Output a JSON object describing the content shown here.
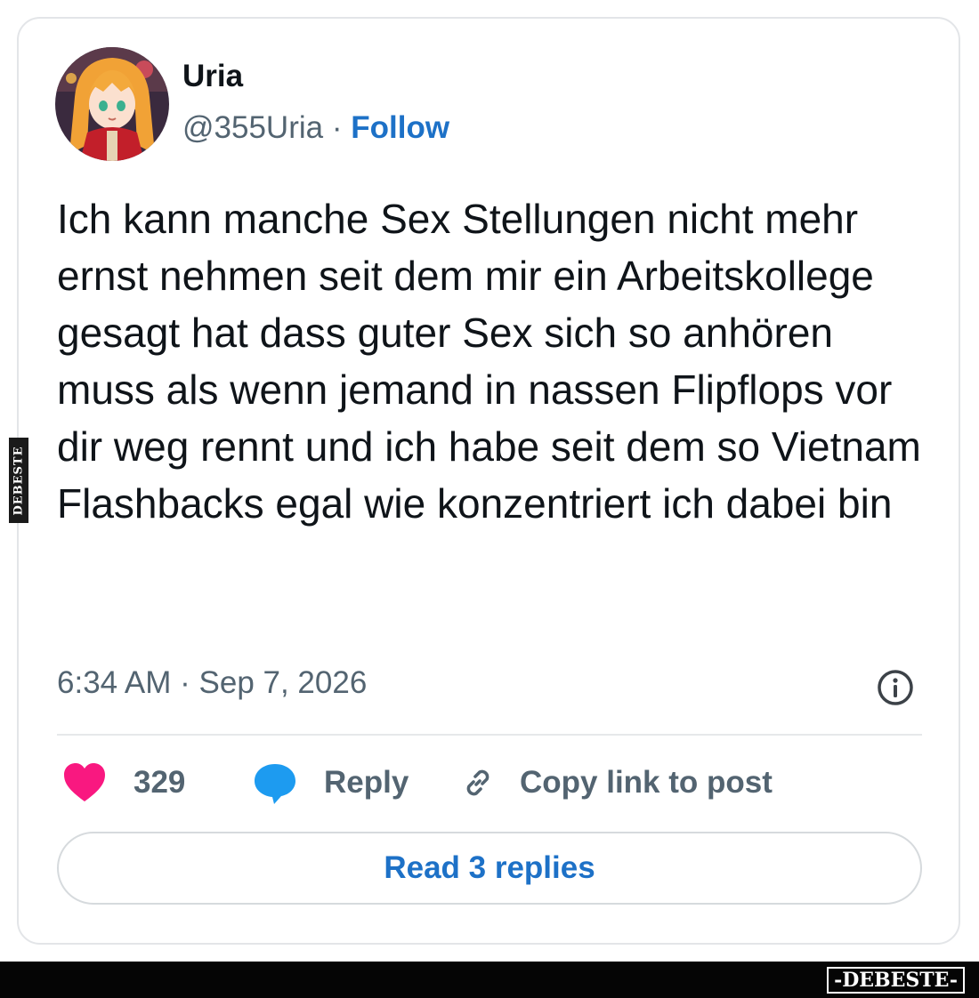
{
  "post": {
    "author_name": "Uria",
    "handle": "@355Uria",
    "separator": "·",
    "follow_label": "Follow",
    "text": "Ich kann manche Sex Stellungen nicht mehr ernst nehmen seit dem mir ein Arbeitskollege gesagt hat dass guter Sex sich so anhören muss als wenn jemand in nassen Flipflops vor dir weg rennt und ich habe seit dem so Vietnam Flashbacks egal wie konzentriert ich dabei bin",
    "timestamp": "6:34 AM · Sep 7, 2026"
  },
  "actions": {
    "like_count": "329",
    "reply_label": "Reply",
    "copy_link_label": "Copy link to post"
  },
  "read_replies_label": "Read 3 replies",
  "watermark": {
    "side_text": "DEBESTE",
    "footer_text": "-DEBESTE-"
  },
  "colors": {
    "link_blue": "#1d71c7",
    "like_pink": "#f91880",
    "reply_blue": "#1d9bf0",
    "secondary_text": "#536471"
  },
  "icons": [
    "avatar",
    "info-icon",
    "heart-icon",
    "speech-bubble-icon",
    "link-icon"
  ]
}
